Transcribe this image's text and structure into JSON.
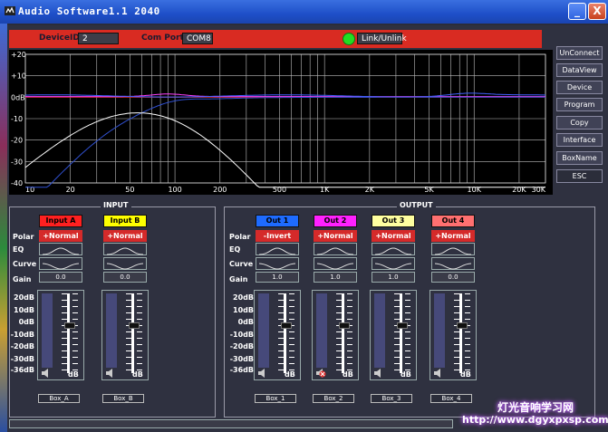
{
  "window": {
    "title": "Audio Software1.1 2040",
    "min_label": "_",
    "close_label": "X"
  },
  "status": {
    "device_id_label": "DeviceID:",
    "device_id_value": "2",
    "com_port_label": "Com Port:",
    "com_port_value": "COM8",
    "link_label": "Link/Unlink"
  },
  "eq_graph": {
    "y_ticks": [
      "+20",
      "+10",
      "0dB",
      "-10",
      "-20",
      "-30",
      "-40"
    ],
    "x_ticks": [
      "10",
      "20",
      "50",
      "100",
      "200",
      "500",
      "1K",
      "2K",
      "5K",
      "10K",
      "20K",
      "30K"
    ]
  },
  "side_menu": [
    "UnConnect",
    "DataView",
    "Device",
    "Program",
    "Copy",
    "Interface",
    "BoxName",
    "ESC"
  ],
  "row_labels": {
    "polar": "Polar",
    "eq": "EQ",
    "curve": "Curve",
    "gain": "Gain"
  },
  "db_labels": [
    "20dB",
    "10dB",
    "0dB",
    "-10dB",
    "-20dB",
    "-30dB",
    "-36dB"
  ],
  "db_unit": "dB",
  "input": {
    "title": "INPUT",
    "channels": [
      {
        "name": "Input A",
        "color": "#ff2020",
        "polar": "+Normal",
        "gain": "0.0",
        "fader_level": 0.62,
        "box": "Box_A"
      },
      {
        "name": "Input B",
        "color": "#ffff00",
        "polar": "+Normal",
        "gain": "0.0",
        "fader_level": 0.62,
        "box": "Box_B"
      }
    ]
  },
  "output": {
    "title": "OUTPUT",
    "channels": [
      {
        "name": "Out 1",
        "color": "#1e6bff",
        "polar": "-Invert",
        "gain": "1.0",
        "fader_level": 0.62,
        "box": "Box_1"
      },
      {
        "name": "Out 2",
        "color": "#ff20ff",
        "polar": "+Normal",
        "gain": "1.0",
        "fader_level": 0.62,
        "box": "Box_2"
      },
      {
        "name": "Out 3",
        "color": "#ffffa0",
        "polar": "+Normal",
        "gain": "1.0",
        "fader_level": 0.62,
        "box": "Box_3"
      },
      {
        "name": "Out 4",
        "color": "#ff7070",
        "polar": "+Normal",
        "gain": "0.0",
        "fader_level": 0.62,
        "box": "Box_4"
      }
    ]
  },
  "watermark": {
    "line1": "灯光音响学习网",
    "line2": "http://www.dgyxpxsp.com"
  }
}
